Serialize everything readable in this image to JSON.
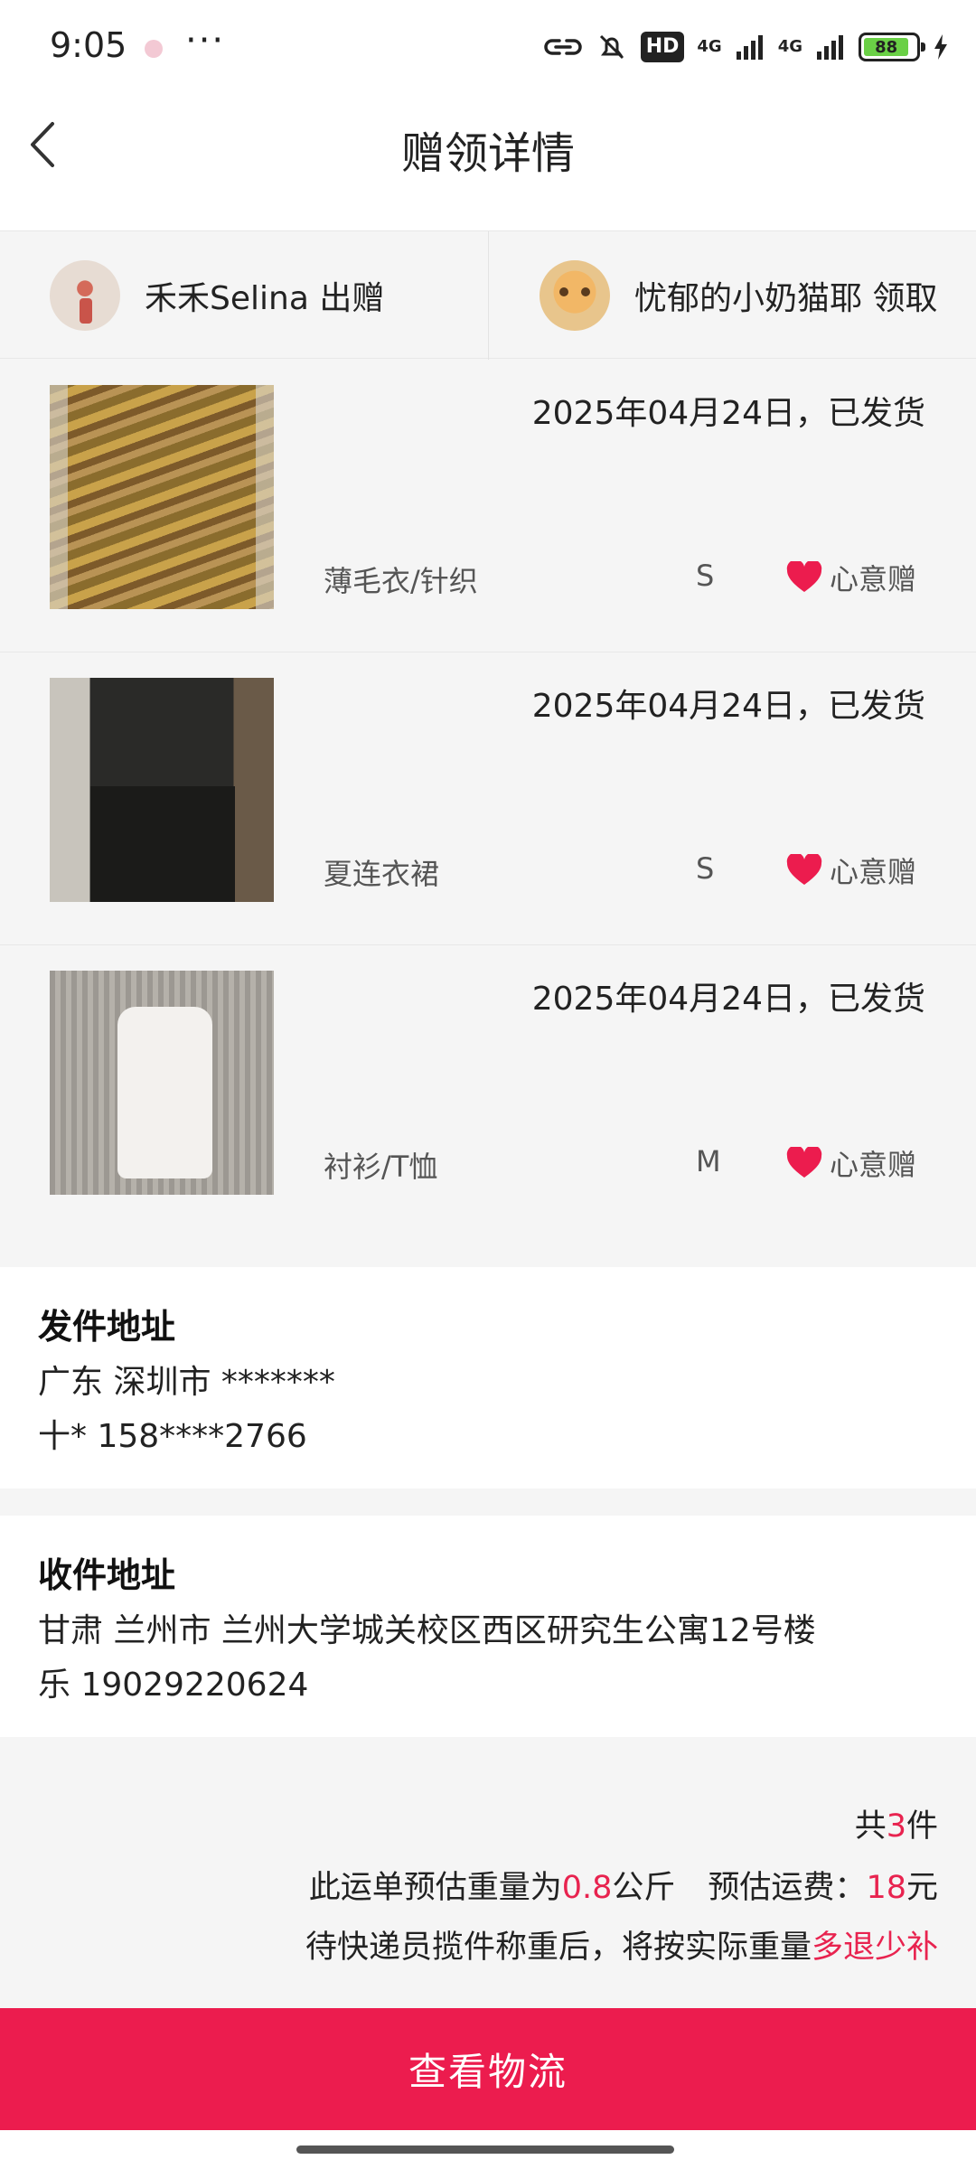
{
  "status_bar": {
    "time": "9:05",
    "more": "···",
    "hd": "HD",
    "net1": "4G",
    "net2": "4G",
    "battery": "88"
  },
  "header": {
    "title": "赠领详情"
  },
  "parties": {
    "giver": "禾禾Selina 出赠",
    "receiver": "忧郁的小奶猫耶 领取"
  },
  "items": [
    {
      "date": "2025年04月24日，已发货",
      "category": "薄毛衣/针织",
      "size": "S",
      "gift": "心意赠"
    },
    {
      "date": "2025年04月24日，已发货",
      "category": "夏连衣裙",
      "size": "S",
      "gift": "心意赠"
    },
    {
      "date": "2025年04月24日，已发货",
      "category": "衬衫/T恤",
      "size": "M",
      "gift": "心意赠"
    }
  ],
  "send_address": {
    "title": "发件地址",
    "line1": "广东 深圳市 *******",
    "line2": "十* 158****2766"
  },
  "recv_address": {
    "title": "收件地址",
    "line1": "甘肃 兰州市 兰州大学城关校区西区研究生公寓12号楼",
    "line2": "乐 19029220624"
  },
  "summary": {
    "count_prefix": "共",
    "count": "3",
    "count_suffix": "件",
    "weight_prefix": "此运单预估重量为",
    "weight": "0.8",
    "weight_unit": "公斤",
    "fee_prefix": "预估运费：",
    "fee": "18",
    "fee_unit": "元",
    "note_prefix": "待快递员揽件称重后，将按实际重量",
    "note_highlight": "多退少补"
  },
  "cta": {
    "label": "查看物流"
  },
  "colors": {
    "accent": "#ec1c4e",
    "highlight": "#e8234f"
  }
}
